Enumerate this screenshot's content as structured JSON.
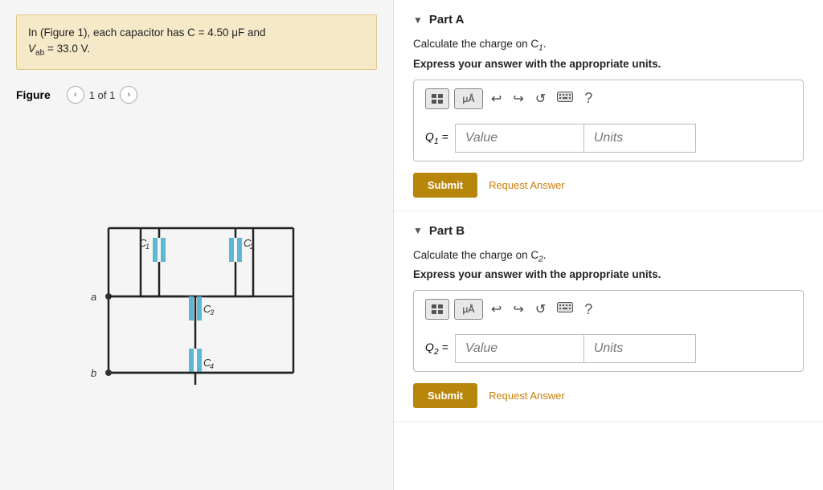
{
  "left": {
    "problem": {
      "line1": "In (Figure 1), each capacitor has C = 4.50 μF and",
      "line2": "V",
      "line2_sub": "ab",
      "line2_rest": " = 33.0 V."
    },
    "figure": {
      "title": "Figure",
      "nav_text": "1 of 1",
      "nav_prev": "‹",
      "nav_next": "›"
    }
  },
  "right": {
    "partA": {
      "title": "Part A",
      "question": "Calculate the charge on C",
      "question_sub": "1",
      "question_end": ".",
      "instruction": "Express your answer with the appropriate units.",
      "label": "Q",
      "label_sub": "1",
      "label_eq": "=",
      "value_placeholder": "Value",
      "units_placeholder": "Units",
      "submit_label": "Submit",
      "request_label": "Request Answer",
      "toolbar": {
        "matrix_label": "⊞",
        "mu_label": "μÅ",
        "undo": "↩",
        "redo": "↪",
        "reset": "↺",
        "keyboard": "⌨",
        "help": "?"
      }
    },
    "partB": {
      "title": "Part B",
      "question": "Calculate the charge on C",
      "question_sub": "2",
      "question_end": ".",
      "instruction": "Express your answer with the appropriate units.",
      "label": "Q",
      "label_sub": "2",
      "label_eq": "=",
      "value_placeholder": "Value",
      "units_placeholder": "Units",
      "submit_label": "Submit",
      "request_label": "Request Answer",
      "toolbar": {
        "matrix_label": "⊞",
        "mu_label": "μÅ",
        "undo": "↩",
        "redo": "↪",
        "reset": "↺",
        "keyboard": "⌨",
        "help": "?"
      }
    }
  },
  "colors": {
    "submit_bg": "#b8860b",
    "request_color": "#c8800a",
    "problem_bg": "#f5e9c8"
  }
}
